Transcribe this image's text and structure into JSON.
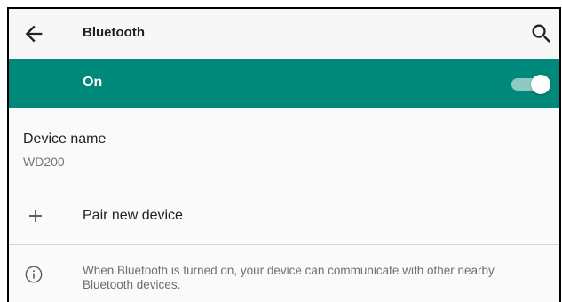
{
  "toolbar": {
    "title": "Bluetooth",
    "back_icon": "arrow-back-icon",
    "search_icon": "search-icon"
  },
  "bluetooth_toggle": {
    "label": "On",
    "state": "on",
    "bar_color": "#00897b"
  },
  "device": {
    "title": "Device name",
    "value": "WD200"
  },
  "pair": {
    "label": "Pair new device",
    "icon": "plus-icon"
  },
  "info": {
    "icon": "info-icon",
    "text": "When Bluetooth is turned on, your device can communicate with other nearby Bluetooth devices."
  }
}
